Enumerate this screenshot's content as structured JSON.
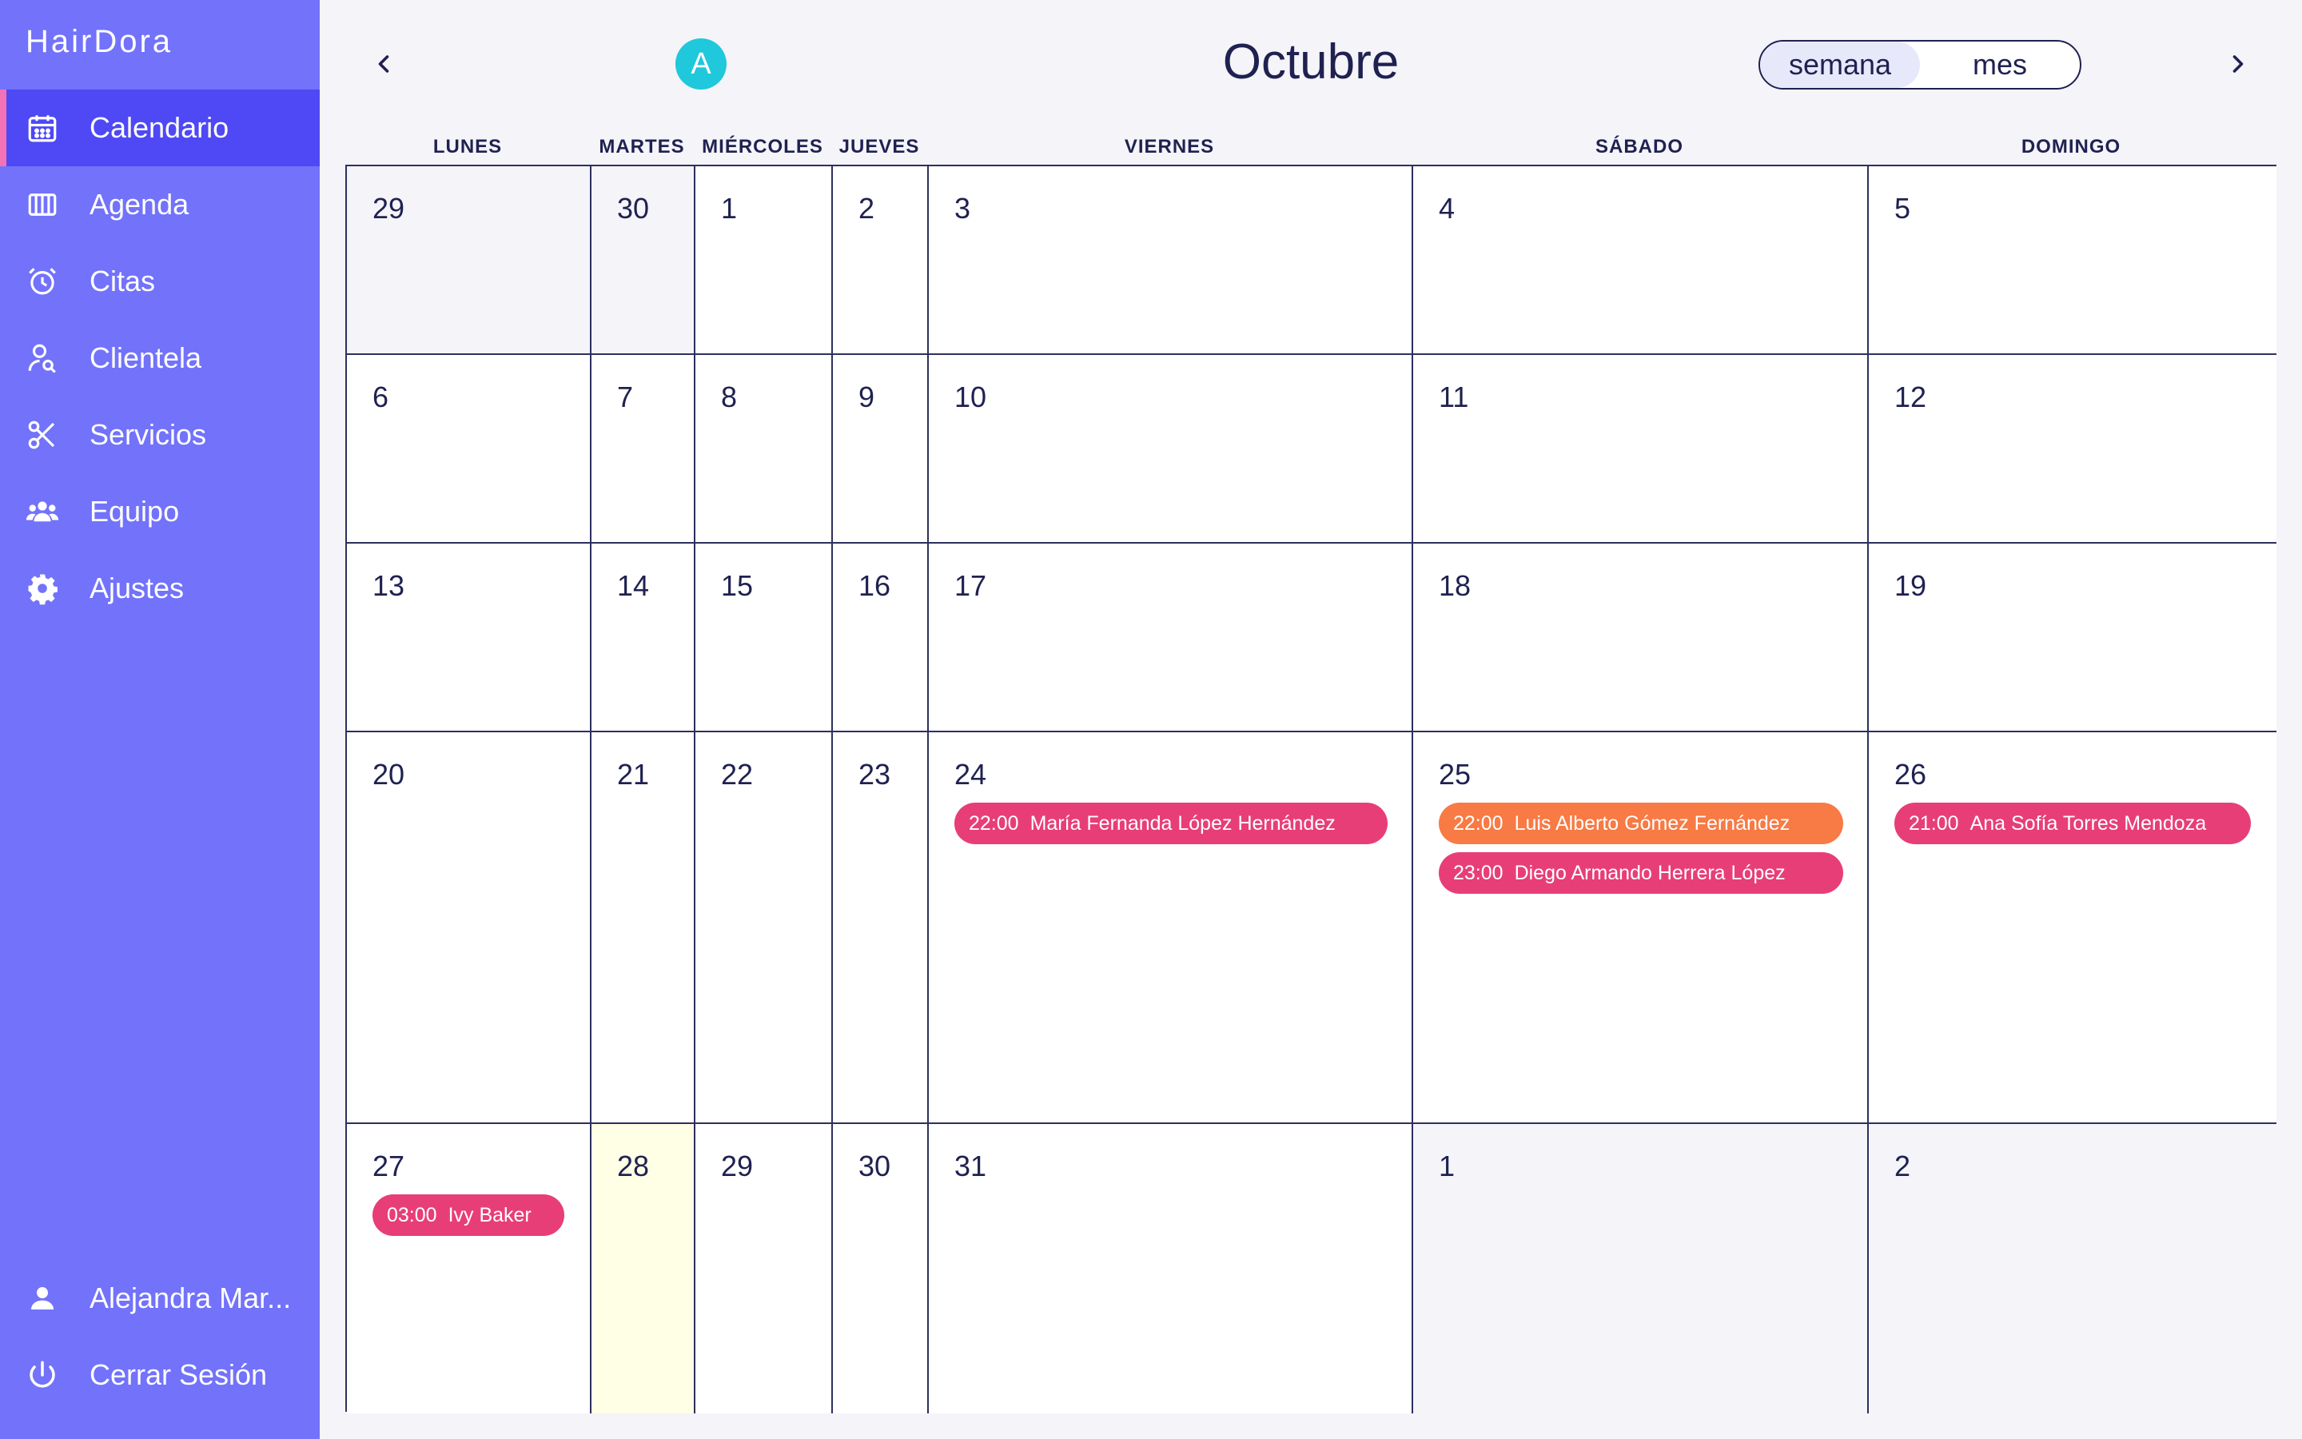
{
  "app": {
    "name": "HairDora"
  },
  "sidebar": {
    "items": [
      {
        "label": "Calendario",
        "icon": "calendar-icon",
        "active": true
      },
      {
        "label": "Agenda",
        "icon": "agenda-icon"
      },
      {
        "label": "Citas",
        "icon": "alarm-clock-icon"
      },
      {
        "label": "Clientela",
        "icon": "user-search-icon"
      },
      {
        "label": "Servicios",
        "icon": "scissors-icon"
      },
      {
        "label": "Equipo",
        "icon": "team-icon"
      },
      {
        "label": "Ajustes",
        "icon": "gear-icon"
      }
    ],
    "user": {
      "label": "Alejandra Mar...",
      "icon": "user-icon"
    },
    "logout": {
      "label": "Cerrar Sesión",
      "icon": "power-icon"
    }
  },
  "header": {
    "month": "Octubre",
    "avatar_letter": "A",
    "view_options": [
      "semana",
      "mes"
    ],
    "selected_view": "semana",
    "prev_icon": "chevron-left-icon",
    "next_icon": "chevron-right-icon"
  },
  "calendar": {
    "weekdays": [
      "LUNES",
      "MARTES",
      "MIÉRCOLES",
      "JUEVES",
      "VIERNES",
      "SÁBADO",
      "DOMINGO"
    ],
    "weeks": [
      [
        "29",
        "30",
        "1",
        "2",
        "3",
        "4",
        "5"
      ],
      [
        "6",
        "7",
        "8",
        "9",
        "10",
        "11",
        "12"
      ],
      [
        "13",
        "14",
        "15",
        "16",
        "17",
        "18",
        "19"
      ],
      [
        "20",
        "21",
        "22",
        "23",
        "24",
        "25",
        "26"
      ],
      [
        "27",
        "28",
        "29",
        "30",
        "31",
        "1",
        "2"
      ]
    ],
    "events": [
      {
        "week": 3,
        "day": 4,
        "time": "22:00",
        "name": "María Fernanda López Hernández",
        "color": "#e83e78"
      },
      {
        "week": 3,
        "day": 5,
        "time": "22:00",
        "name": "Luis Alberto Gómez Fernández",
        "color": "#f87a44"
      },
      {
        "week": 3,
        "day": 5,
        "time": "23:00",
        "name": "Diego Armando Herrera López",
        "color": "#e83e78"
      },
      {
        "week": 3,
        "day": 6,
        "time": "21:00",
        "name": "Ana Sofía Torres Mendoza",
        "color": "#e83e78"
      },
      {
        "week": 4,
        "day": 0,
        "time": "03:00",
        "name": "Ivy Baker",
        "color": "#e83e78"
      }
    ]
  },
  "colors": {
    "sidebar": "#7272fb",
    "sidebar_active": "#4f48f5",
    "accent_bar": "#f472b6",
    "today": "#ffffe6",
    "event_pink": "#e83e78",
    "event_orange": "#f87a44",
    "avatar": "#1fc8db"
  }
}
